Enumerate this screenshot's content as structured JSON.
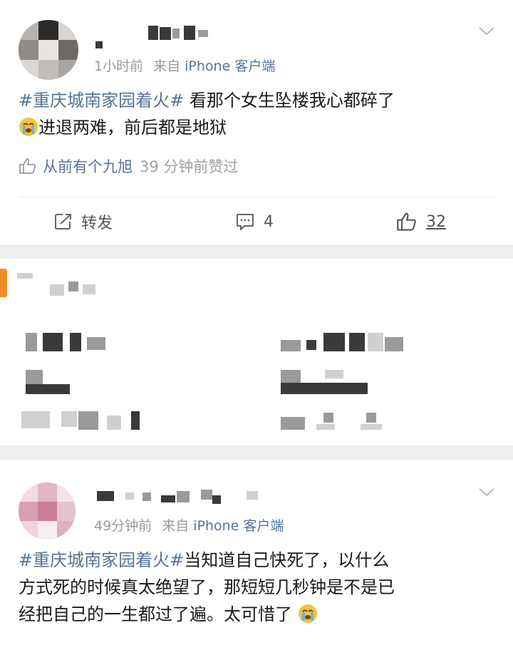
{
  "posts": [
    {
      "time": "1小时前",
      "source": "来自",
      "client": "iPhone 客户端",
      "topic": "#重庆城南家园着火#",
      "text_line1": " 看那个女生坠楼我心都碎了",
      "text_line2": "进退两难，前后都是地狱",
      "emoji": "crying-face",
      "liked_by": "从前有个九旭",
      "liked_when": "39 分钟前赞过",
      "repost_label": "转发",
      "comment_count": "4",
      "like_count": "32"
    },
    {
      "time": "49分钟前",
      "source": "来自",
      "client": "iPhone 客户端",
      "topic": "#重庆城南家园着火#",
      "text_line1": "当知道自己快死了，以什么",
      "text_line2": "方式死的时候真太绝望了，那短短几秒钟是不是已",
      "text_line3": "经把自己的一生都过了遍。太可惜了",
      "emoji": "crying-face"
    }
  ],
  "colors": {
    "link": "#557499",
    "meta": "#9b9b9b",
    "separator": "#eeeeee",
    "ad_accent": "#f28c28"
  },
  "icons": [
    "chevron-down-icon",
    "repost-icon",
    "comment-icon",
    "like-icon",
    "crying-face-emoji"
  ]
}
